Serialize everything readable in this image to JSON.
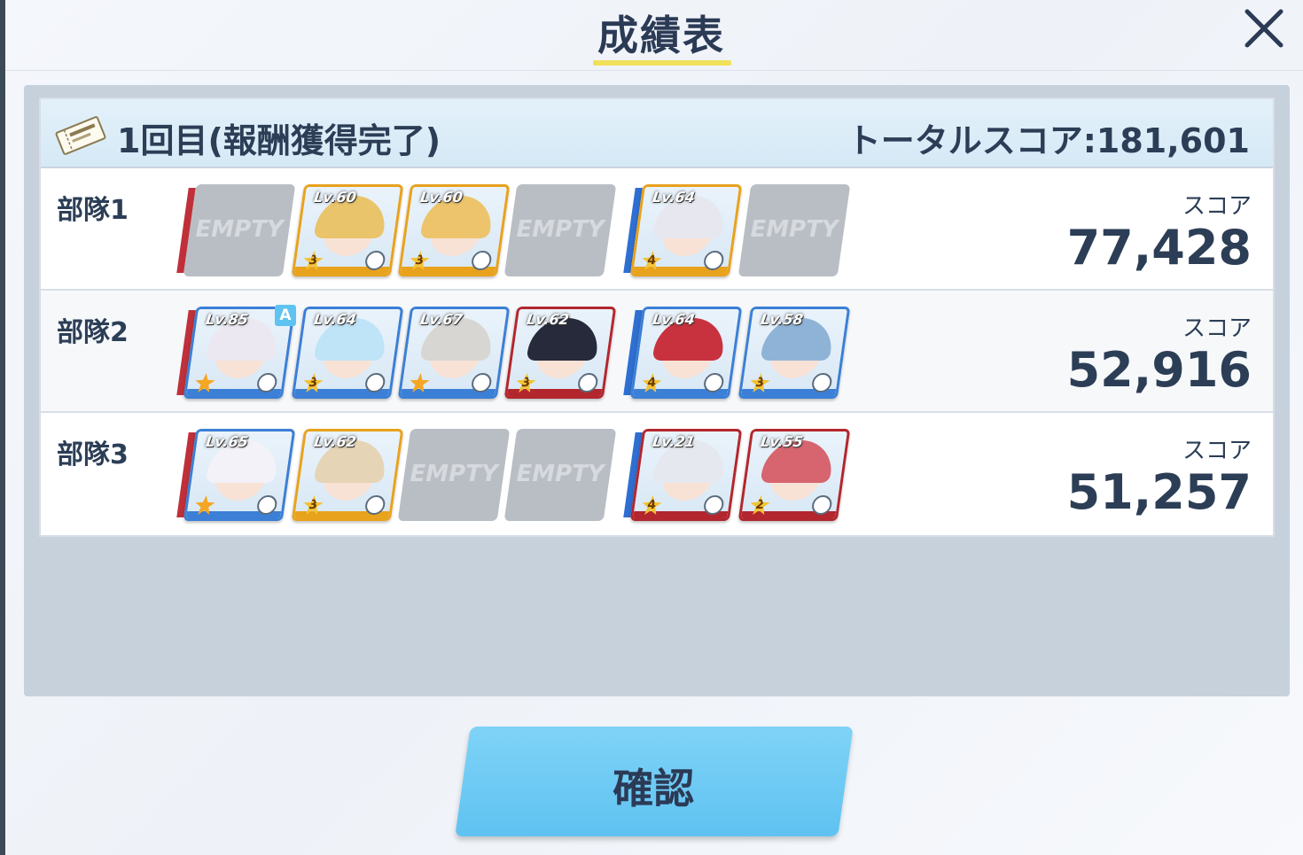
{
  "header": {
    "title": "成績表"
  },
  "round": {
    "label": "1回目(報酬獲得完了)",
    "total_label": "トータルスコア:181,601"
  },
  "colors": {
    "red_bar": "#c0303a",
    "blue_bar": "#2f6fd2",
    "accent": "#f1e05a",
    "button": "#6ccaf4"
  },
  "empty_label": "EMPTY",
  "teams": [
    {
      "label": "部隊1",
      "score_label": "スコア",
      "score": "77,428",
      "members": [
        {
          "empty": true
        },
        {
          "lv": "Lv.60",
          "star": "3",
          "hair": "#e9c46a",
          "frame": "#e8a21c",
          "role": "target-icon"
        },
        {
          "lv": "Lv.60",
          "star": "3",
          "hair": "#edc46b",
          "frame": "#e8a21c",
          "role": "target-icon"
        },
        {
          "empty": true
        },
        {
          "lv": "Lv.64",
          "star": "4",
          "hair": "#e7e7ef",
          "frame": "#e8a21c",
          "role": "support-icon"
        },
        {
          "empty": true
        }
      ]
    },
    {
      "label": "部隊2",
      "score_label": "スコア",
      "score": "52,916",
      "members": [
        {
          "lv": "Lv.85",
          "star": "",
          "hair": "#ece8f2",
          "frame": "#3b7fd6",
          "role": "target-icon",
          "badge": "A"
        },
        {
          "lv": "Lv.64",
          "star": "3",
          "hair": "#bfe3f7",
          "frame": "#3b7fd6",
          "role": "target-icon"
        },
        {
          "lv": "Lv.67",
          "star": "",
          "hair": "#d8d6d2",
          "frame": "#3b7fd6",
          "role": "target-icon"
        },
        {
          "lv": "Lv.62",
          "star": "3",
          "hair": "#262a3a",
          "frame": "#b3262e",
          "role": "support-icon"
        },
        {
          "lv": "Lv.64",
          "star": "4",
          "hair": "#c8323f",
          "frame": "#3b7fd6",
          "role": "gear-icon"
        },
        {
          "lv": "Lv.58",
          "star": "3",
          "hair": "#8fb3d7",
          "frame": "#3b7fd6",
          "role": "support-icon"
        }
      ]
    },
    {
      "label": "部隊3",
      "score_label": "スコア",
      "score": "51,257",
      "members": [
        {
          "lv": "Lv.65",
          "star": "",
          "hair": "#f2f2f8",
          "frame": "#3b7fd6",
          "role": "target-icon"
        },
        {
          "lv": "Lv.62",
          "star": "3",
          "hair": "#e6d4b6",
          "frame": "#e8a21c",
          "role": "shield-icon"
        },
        {
          "empty": true
        },
        {
          "empty": true
        },
        {
          "lv": "Lv.21",
          "star": "4",
          "hair": "#e6e8ef",
          "frame": "#b3262e",
          "role": "target-icon"
        },
        {
          "lv": "Lv.55",
          "star": "2",
          "hair": "#d6656f",
          "frame": "#b3262e",
          "role": "support-icon"
        }
      ]
    }
  ],
  "confirm_label": "確認"
}
